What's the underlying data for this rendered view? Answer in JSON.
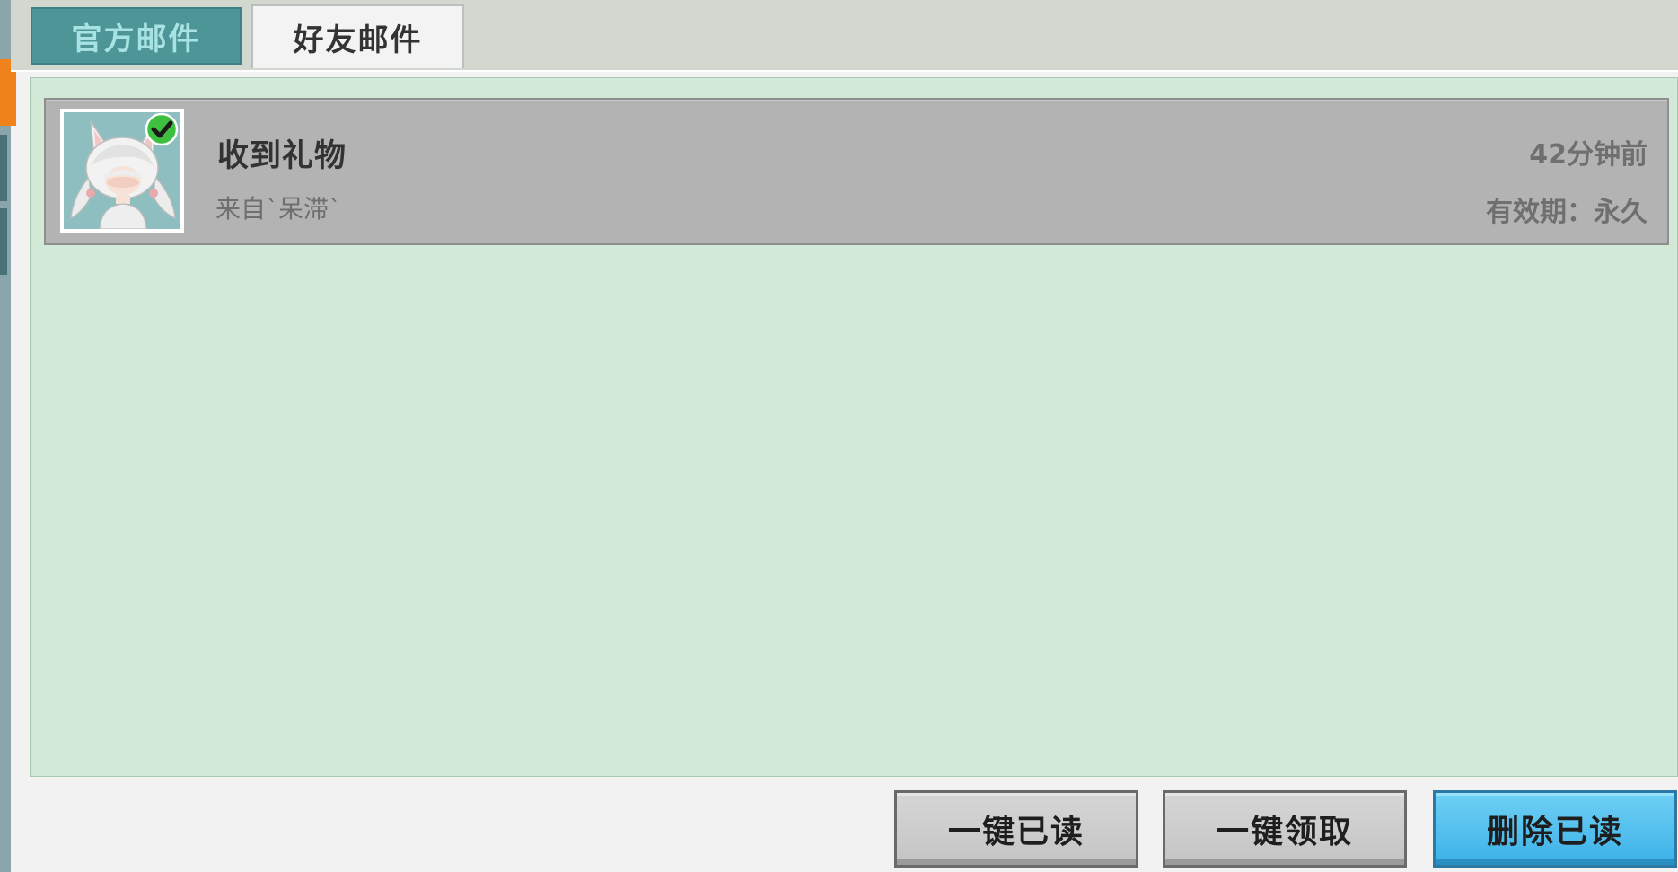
{
  "tabs": {
    "official": "官方邮件",
    "friend": "好友邮件"
  },
  "mail_list": [
    {
      "title": "收到礼物",
      "from": "来自`呆滞`",
      "time": "42分钟前",
      "expiry": "有效期：永久",
      "read": true
    }
  ],
  "buttons": {
    "read_all": "一键已读",
    "claim_all": "一键领取",
    "delete_read": "删除已读"
  },
  "colors": {
    "panel_bg": "#d2e9d8",
    "tab_inactive": "#4d9597",
    "primary_button": "#3cb1e8"
  },
  "icons": {
    "read_badge": "check-circle-icon",
    "sender_avatar": "character-avatar"
  }
}
